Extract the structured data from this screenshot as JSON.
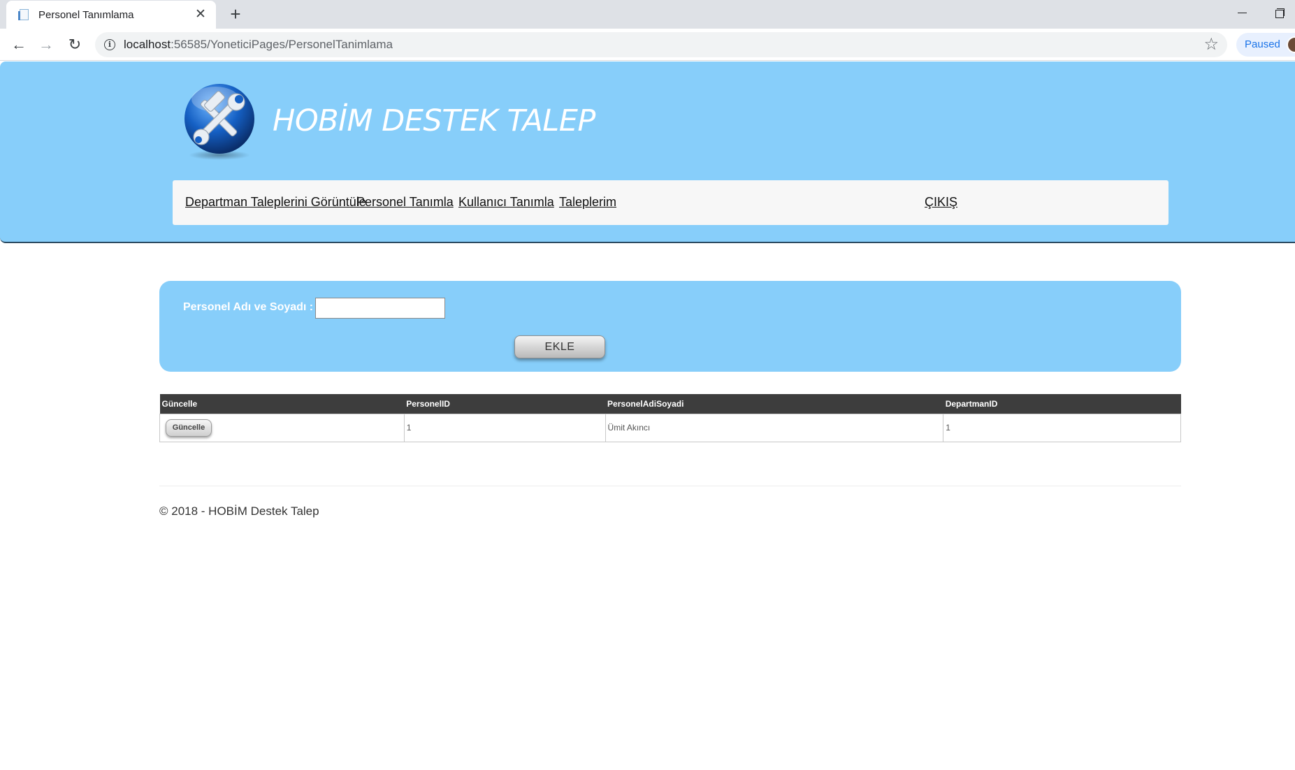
{
  "browser": {
    "tab_title": "Personel Tanımlama",
    "tab_close": "✕",
    "new_tab": "+",
    "url_host": "localhost",
    "url_rest": ":56585/YoneticiPages/PersonelTanimlama",
    "paused_label": "Paused"
  },
  "header": {
    "site_title": "HOBİM DESTEK TALEP",
    "logo_icon": "hammer-wrench-icon",
    "menu": [
      {
        "label": "Departman Taleplerini Görüntüle"
      },
      {
        "label": "Personel Tanımla"
      },
      {
        "label": "Kullanıcı Tanımla"
      },
      {
        "label": "Taleplerim"
      },
      {
        "label": "ÇIKIŞ"
      }
    ]
  },
  "form": {
    "label": "Personel Adı ve Soyadı :",
    "input_value": "",
    "submit_label": "EKLE"
  },
  "table": {
    "headers": [
      "Güncelle",
      "PersonelID",
      "PersonelAdiSoyadi",
      "DepartmanID"
    ],
    "rows": [
      {
        "button_label": "Güncelle",
        "personel_id": "1",
        "personel_adi_soyadi": "Ümit Akıncı",
        "departman_id": "1"
      }
    ]
  },
  "footer": {
    "text": "© 2018 - HOBİM Destek Talep"
  },
  "colors": {
    "header_bg": "#87cefa",
    "table_header_bg": "#3d3d3d"
  }
}
